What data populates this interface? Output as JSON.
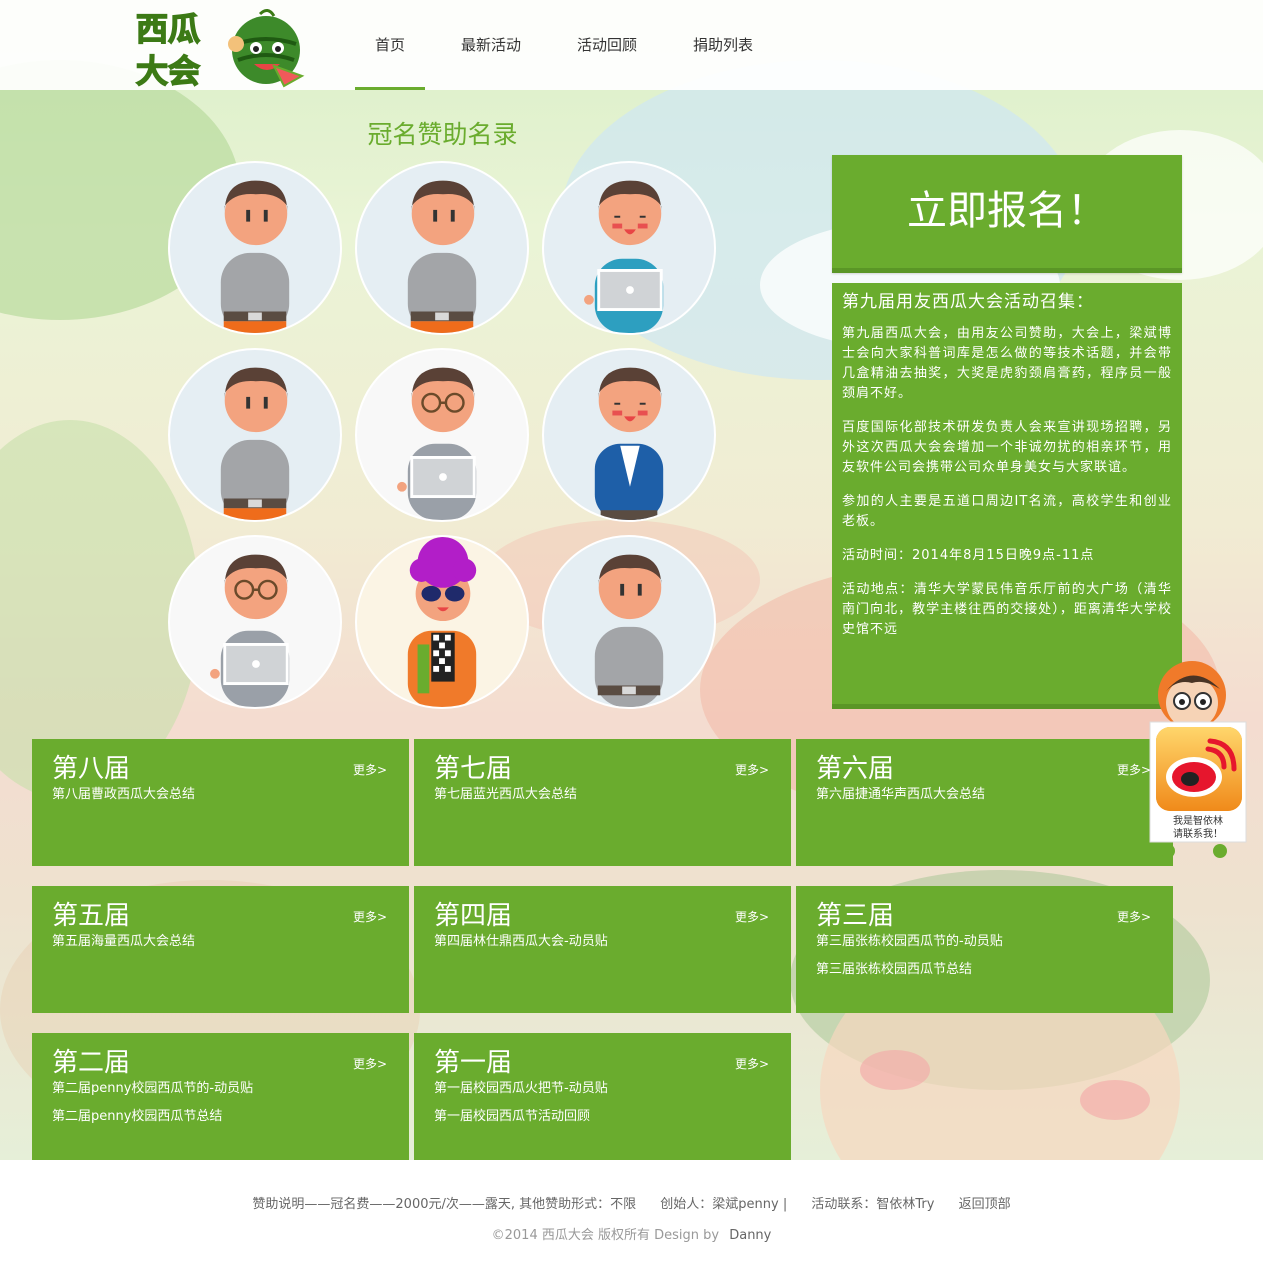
{
  "brand": {
    "logo_text_line1": "西瓜",
    "logo_text_line2": "大会"
  },
  "nav": {
    "items": [
      {
        "label": "首页",
        "active": true
      },
      {
        "label": "最新活动",
        "active": false
      },
      {
        "label": "活动回顾",
        "active": false
      },
      {
        "label": "捐助列表",
        "active": false
      }
    ]
  },
  "sponsors": {
    "title": "冠名赞助名录",
    "avatars": [
      "avatar-grey-shirt-icon",
      "avatar-grey-shirt-icon",
      "avatar-laptop-blue-icon",
      "avatar-grey-shirt-icon",
      "avatar-glasses-laptop-icon",
      "avatar-blue-jacket-icon",
      "avatar-glasses-laptop-icon",
      "avatar-purple-hair-icon",
      "avatar-grey-shirt-icon"
    ]
  },
  "signup": {
    "label": "立即报名！"
  },
  "notice": {
    "title": "第九届用友西瓜大会活动召集：",
    "paragraphs": [
      "第九届西瓜大会，由用友公司赞助，大会上，梁斌博士会向大家科普词库是怎么做的等技术话题，并会带几盒精油去抽奖，大奖是虎豹颈肩膏药，程序员一般颈肩不好。",
      "百度国际化部技术研发负责人会来宣讲现场招聘，另外这次西瓜大会会增加一个非诚勿扰的相亲环节，用友软件公司会携带公司众单身美女与大家联谊。",
      "参加的人主要是五道口周边IT名流，高校学生和创业老板。",
      "活动时间：2014年8月15日晚9点-11点",
      "活动地点：清华大学蒙民伟音乐厅前的大广场（清华南门向北，教学主楼往西的交接处），距离清华大学校史馆不远"
    ]
  },
  "sessions": {
    "more_label": "更多>",
    "cards": [
      {
        "title": "第八届",
        "links": [
          "第八届曹政西瓜大会总结"
        ]
      },
      {
        "title": "第七届",
        "links": [
          "第七届蓝光西瓜大会总结"
        ]
      },
      {
        "title": "第六届",
        "links": [
          "第六届捷通华声西瓜大会总结"
        ]
      },
      {
        "title": "第五届",
        "links": [
          "第五届海量西瓜大会总结"
        ]
      },
      {
        "title": "第四届",
        "links": [
          "第四届林仕鼎西瓜大会-动员贴"
        ]
      },
      {
        "title": "第三届",
        "links": [
          "第三届张栋校园西瓜节的-动员贴",
          "第三届张栋校园西瓜节总结"
        ]
      },
      {
        "title": "第二届",
        "links": [
          "第二届penny校园西瓜节的-动员贴",
          "第二届penny校园西瓜节总结"
        ]
      },
      {
        "title": "第一届",
        "links": [
          "第一届校园西瓜火把节-动员贴",
          "第一届校园西瓜节活动回顾"
        ]
      }
    ]
  },
  "weibo": {
    "line1": "我是智依林",
    "line2": "请联系我！"
  },
  "footer": {
    "sponsor_note": "赞助说明——冠名费——2000元/次——露天, 其他赞助形式：不限",
    "founder": "创始人：梁斌penny |",
    "contact": "活动联系：智依林Try",
    "back_to_top": "返回顶部",
    "copyright": "©2014 西瓜大会 版权所有 Design by",
    "designer": "Danny"
  },
  "colors": {
    "accent": "#6aac2e",
    "accent_dark": "#5a9626",
    "title_green": "#6aac2e"
  }
}
